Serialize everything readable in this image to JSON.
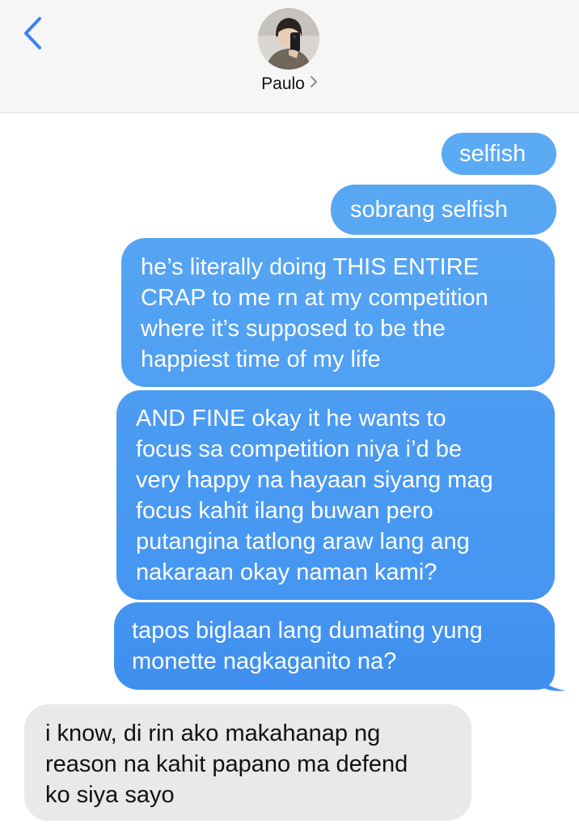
{
  "header": {
    "contact_name": "Paulo",
    "back_icon": "chevron-left-icon",
    "contact_chevron_icon": "chevron-right-icon"
  },
  "colors": {
    "accent": "#3b82f6",
    "outgoing_bubble_top": "#5aaaf4",
    "outgoing_bubble_bottom": "#3f8ff0",
    "incoming_bubble": "#e9e9eb",
    "header_bg": "#f6f6f6"
  },
  "messages": [
    {
      "direction": "outgoing",
      "text": "selfish"
    },
    {
      "direction": "outgoing",
      "text": "sobrang selfish"
    },
    {
      "direction": "outgoing",
      "text": "he’s literally doing THIS ENTIRE\nCRAP to me rn at my competition\nwhere it’s supposed to be the\nhappiest time of my life"
    },
    {
      "direction": "outgoing",
      "text": "AND FINE okay it he wants to\nfocus sa competition niya i’d be\nvery happy na hayaan siyang mag\nfocus kahit ilang buwan pero\nputangina tatlong araw lang ang\nnakaraan okay naman kami?"
    },
    {
      "direction": "outgoing",
      "text": "tapos biglaan lang dumating yung\nmonette nagkaganito na?"
    },
    {
      "direction": "incoming",
      "text": "i know, di rin ako makahanap ng\nreason na kahit papano ma defend\nko siya sayo"
    }
  ]
}
